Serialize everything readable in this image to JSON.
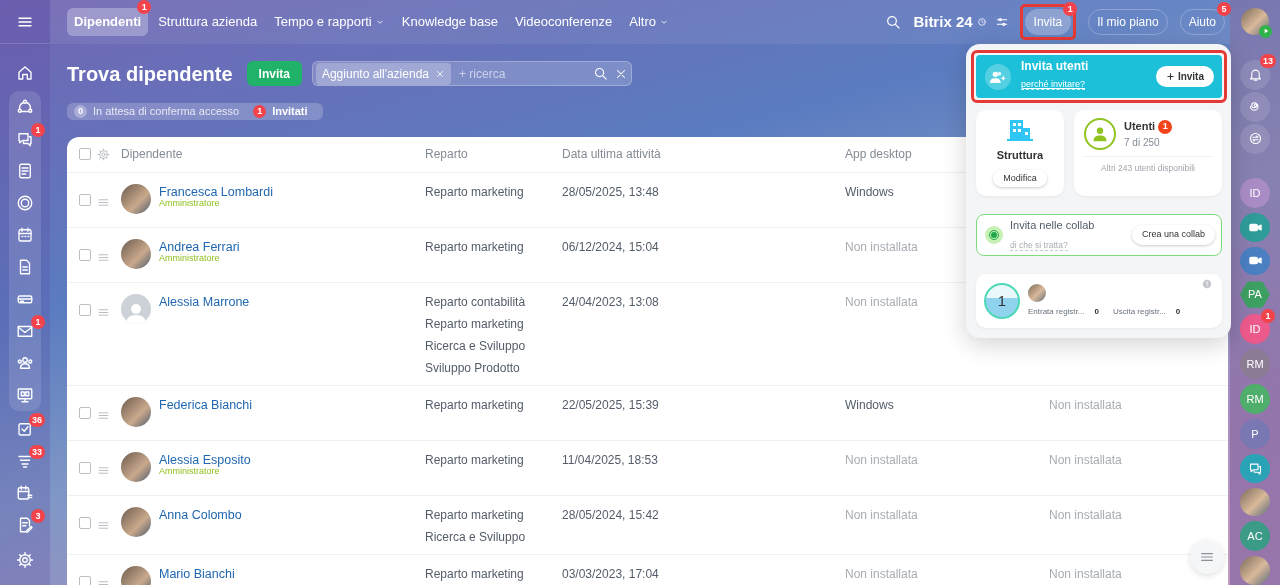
{
  "sidebar": {
    "sections": [
      {
        "framed": false,
        "items": [
          {
            "kind": "home"
          }
        ]
      },
      {
        "framed": true,
        "items": [
          {
            "kind": "flow"
          },
          {
            "kind": "chat",
            "badge": "1"
          },
          {
            "kind": "feed"
          },
          {
            "kind": "ring"
          },
          {
            "kind": "calendar"
          },
          {
            "kind": "document"
          },
          {
            "kind": "drive"
          },
          {
            "kind": "mail",
            "badge": "1"
          },
          {
            "kind": "people"
          },
          {
            "kind": "board"
          }
        ]
      },
      {
        "framed": false,
        "items": [
          {
            "kind": "tasks",
            "badge": "36"
          },
          {
            "kind": "funnel",
            "badge": "33"
          },
          {
            "kind": "planner"
          },
          {
            "kind": "sign",
            "badge": "3"
          }
        ]
      }
    ]
  },
  "top_nav": {
    "tabs": [
      {
        "label": "Dipendenti",
        "selected": true,
        "dropdown": false,
        "badge": "1"
      },
      {
        "label": "Struttura azienda",
        "selected": false,
        "dropdown": false
      },
      {
        "label": "Tempo e rapporti",
        "selected": false,
        "dropdown": true
      },
      {
        "label": "Knowledge base",
        "selected": false,
        "dropdown": false
      },
      {
        "label": "Videoconferenze",
        "selected": false,
        "dropdown": false
      },
      {
        "label": "Altro",
        "selected": false,
        "dropdown": true
      }
    ]
  },
  "header_right": {
    "logo": {
      "name": "Bitrix",
      "number": "24"
    },
    "buttons": [
      {
        "label": "Invita",
        "badge": "1",
        "highlighted": true
      },
      {
        "label": "Il mio piano",
        "highlighted": false
      },
      {
        "label": "Aiuto",
        "badge": "5",
        "highlighted": false
      }
    ]
  },
  "page": {
    "title": "Trova dipendente",
    "invite_button": "Invita",
    "search": {
      "chips": [
        "Aggiunto all'azienda"
      ],
      "placeholder": "+ ricerca"
    },
    "counters": [
      {
        "count": "0",
        "label": "In attesa di conferma accesso",
        "alert": false
      },
      {
        "count": "1",
        "label": "Invitati",
        "alert": true
      }
    ]
  },
  "table": {
    "select_all_checked": false,
    "columns": [
      "Dipendente",
      "Reparto",
      "Data ultima attività",
      "App desktop"
    ],
    "rows": [
      {
        "checked": false,
        "name": "Francesca Lombardi",
        "role": "Amministratore",
        "photo": true,
        "departments": [
          "Reparto marketing"
        ],
        "last_activity": "28/05/2025, 13:48",
        "app_desktop": "Windows",
        "app_installed": true
      },
      {
        "checked": false,
        "name": "Andrea Ferrari",
        "role": "Amministratore",
        "photo": true,
        "departments": [
          "Reparto marketing"
        ],
        "last_activity": "06/12/2024, 15:04",
        "app_desktop": "Non installata",
        "app_installed": false
      },
      {
        "checked": false,
        "name": "Alessia Marrone",
        "photo": false,
        "departments": [
          "Reparto contabilità",
          "Reparto marketing",
          "Ricerca e Sviluppo",
          "Sviluppo Prodotto"
        ],
        "last_activity": "24/04/2023, 13:08",
        "app_desktop": "Non installata",
        "app_installed": false
      },
      {
        "checked": false,
        "name": "Federica Bianchi",
        "photo": true,
        "departments": [
          "Reparto marketing"
        ],
        "last_activity": "22/05/2025, 15:39",
        "app_desktop": "Windows",
        "app_installed": true,
        "column_5": "Non installata"
      },
      {
        "checked": false,
        "name": "Alessia Esposito",
        "role": "Amministratore",
        "photo": true,
        "departments": [
          "Reparto marketing"
        ],
        "last_activity": "11/04/2025, 18:53",
        "app_desktop": "Non installata",
        "app_installed": false,
        "column_5": "Non installata"
      },
      {
        "checked": false,
        "name": "Anna Colombo",
        "photo": true,
        "departments": [
          "Reparto marketing",
          "Ricerca e Sviluppo"
        ],
        "last_activity": "28/05/2024, 15:42",
        "app_desktop": "Non installata",
        "app_installed": false,
        "column_5": "Non installata"
      },
      {
        "checked": false,
        "name": "Mario Bianchi",
        "photo": true,
        "departments": [
          "Reparto marketing"
        ],
        "last_activity": "03/03/2023, 17:04",
        "app_desktop": "Non installata",
        "app_installed": false,
        "column_5": "Non installata"
      }
    ]
  },
  "invite_popup": {
    "invite_card": {
      "title": "Invita utenti",
      "link": "perché invitare?",
      "button": "Invita",
      "highlighted": true
    },
    "structure": {
      "title": "Struttura",
      "button": "Modifica"
    },
    "users": {
      "title": "Utenti",
      "badge": "1",
      "count": "7 di 250",
      "available": "Altri 243 utenti disponibili"
    },
    "collab": {
      "title": "Invita nelle collab",
      "link": "di che si tratta?",
      "button": "Crea una collab"
    },
    "timeman": {
      "count": "1",
      "stats": [
        {
          "label": "Entrata registr...",
          "value": "0"
        },
        {
          "label": "Uscita registr...",
          "value": "0"
        }
      ]
    }
  },
  "right_bar": {
    "notifications_badge": "13",
    "chats": [
      {
        "kind": "initials",
        "text": "ID",
        "color": "#a98bc6"
      },
      {
        "kind": "video",
        "color": "#2f9c9a"
      },
      {
        "kind": "video",
        "color": "#4a7fc2"
      },
      {
        "kind": "hexagon",
        "text": "PA",
        "color": "#3d9f62"
      },
      {
        "kind": "initials",
        "text": "ID",
        "color": "#ec5a8c",
        "badge": "1"
      },
      {
        "kind": "initials",
        "text": "RM",
        "color": "#8b7c93"
      },
      {
        "kind": "initials",
        "text": "RM",
        "color": "#4fae6c"
      },
      {
        "kind": "initials",
        "text": "P",
        "color": "#7a78b2"
      },
      {
        "kind": "chat",
        "color": "#2aa3b6"
      },
      {
        "kind": "photo"
      },
      {
        "kind": "initials",
        "text": "AC",
        "color": "#3c9b87"
      },
      {
        "kind": "photo"
      }
    ]
  }
}
